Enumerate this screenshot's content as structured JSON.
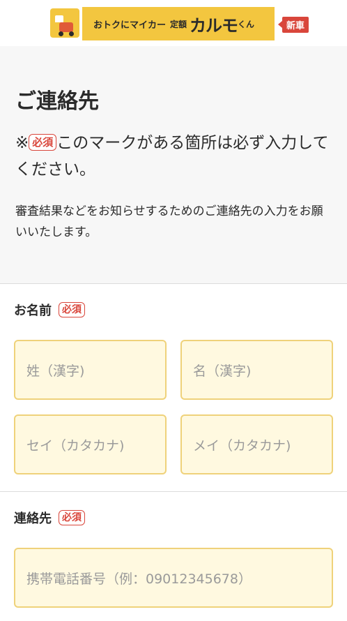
{
  "header": {
    "tagline": "おトクにマイカー",
    "mid": "定額",
    "brand": "カルモ",
    "brand_suffix": "くん",
    "badge": "新車"
  },
  "intro": {
    "title": "ご連絡先",
    "notice_prefix": "※",
    "required_badge": "必須",
    "notice_text": "このマークがある箇所は必ず入力してください。",
    "description": "審査結果などをお知らせするためのご連絡先の入力をお願いいたします。"
  },
  "name_section": {
    "label": "お名前",
    "required_badge": "必須",
    "last_name_kanji_placeholder": "姓（漢字)",
    "first_name_kanji_placeholder": "名（漢字)",
    "last_name_kana_placeholder": "セイ（カタカナ)",
    "first_name_kana_placeholder": "メイ（カタカナ)"
  },
  "contact_section": {
    "label": "連絡先",
    "required_badge": "必須",
    "phone_placeholder": "携帯電話番号（例：09012345678）"
  },
  "colors": {
    "brand_yellow": "#f3c63f",
    "badge_red": "#d9463b",
    "input_bg": "#fff9e0",
    "input_border": "#efd27a"
  }
}
